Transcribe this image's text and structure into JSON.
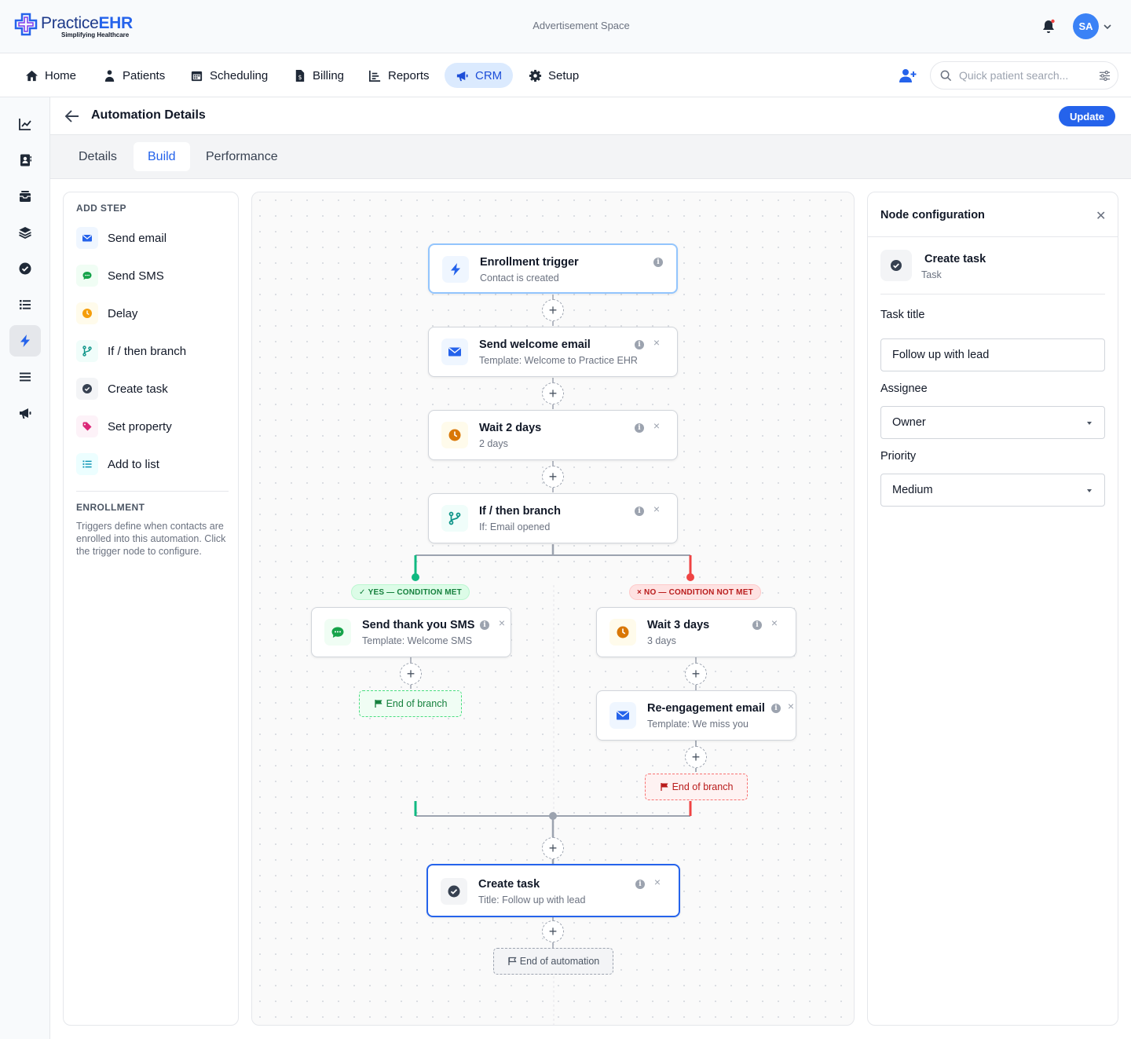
{
  "header": {
    "logo_brand_a": "Practice",
    "logo_brand_b": "EHR",
    "logo_tagline": "Simplifying Healthcare",
    "ad_space": "Advertisement Space",
    "avatar_initials": "SA"
  },
  "nav": {
    "items": [
      {
        "label": "Home",
        "icon": "home-icon"
      },
      {
        "label": "Patients",
        "icon": "patients-icon"
      },
      {
        "label": "Scheduling",
        "icon": "calendar-icon"
      },
      {
        "label": "Billing",
        "icon": "billing-icon"
      },
      {
        "label": "Reports",
        "icon": "reports-icon"
      },
      {
        "label": "CRM",
        "icon": "megaphone-icon",
        "active": true
      },
      {
        "label": "Setup",
        "icon": "gear-icon"
      }
    ],
    "search_placeholder": "Quick patient search..."
  },
  "rail": [
    "chart-line-icon",
    "contacts-icon",
    "inbox-icon",
    "layers-icon",
    "check-circle-icon",
    "list-icon",
    "bolt-icon",
    "menu-icon",
    "megaphone-icon"
  ],
  "page": {
    "title": "Automation Details",
    "update_label": "Update",
    "tabs": [
      "Details",
      "Build",
      "Performance"
    ],
    "active_tab": "Build"
  },
  "add_step": {
    "heading": "ADD STEP",
    "items": [
      {
        "label": "Send email",
        "icon": "mail-icon",
        "color": "#2563eb"
      },
      {
        "label": "Send SMS",
        "icon": "sms-icon",
        "color": "#16a34a"
      },
      {
        "label": "Delay",
        "icon": "clock-icon",
        "color": "#f59e0b"
      },
      {
        "label": "If / then branch",
        "icon": "branch-icon",
        "color": "#0d9488"
      },
      {
        "label": "Create task",
        "icon": "check-circle-icon",
        "color": "#374151"
      },
      {
        "label": "Set property",
        "icon": "tag-icon",
        "color": "#db2777"
      },
      {
        "label": "Add to list",
        "icon": "list-icon",
        "color": "#0891b2"
      }
    ],
    "enrollment_heading": "ENROLLMENT",
    "enrollment_text": "Triggers define when contacts are enrolled into this automation. Click the trigger node to configure."
  },
  "flow": {
    "trigger": {
      "title": "Enrollment trigger",
      "sub": "Contact is created"
    },
    "welcome": {
      "title": "Send welcome email",
      "sub": "Template: Welcome to Practice EHR"
    },
    "wait2": {
      "title": "Wait 2 days",
      "sub": "2 days"
    },
    "branch": {
      "title": "If / then branch",
      "sub": "If: Email opened"
    },
    "yes_label": "YES — CONDITION MET",
    "no_label": "NO — CONDITION NOT MET",
    "sms": {
      "title": "Send thank you SMS",
      "sub": "Template: Welcome SMS"
    },
    "wait3": {
      "title": "Wait 3 days",
      "sub": "3 days"
    },
    "reengage": {
      "title": "Re-engagement email",
      "sub": "Template: We miss you"
    },
    "end_branch": "End of branch",
    "task": {
      "title": "Create task",
      "sub": "Title: Follow up with lead"
    },
    "end_automation": "End of automation"
  },
  "config": {
    "heading": "Node configuration",
    "node_title": "Create task",
    "node_type": "Task",
    "task_title_label": "Task title",
    "task_title_value": "Follow up with lead",
    "assignee_label": "Assignee",
    "assignee_value": "Owner",
    "priority_label": "Priority",
    "priority_value": "Medium"
  }
}
